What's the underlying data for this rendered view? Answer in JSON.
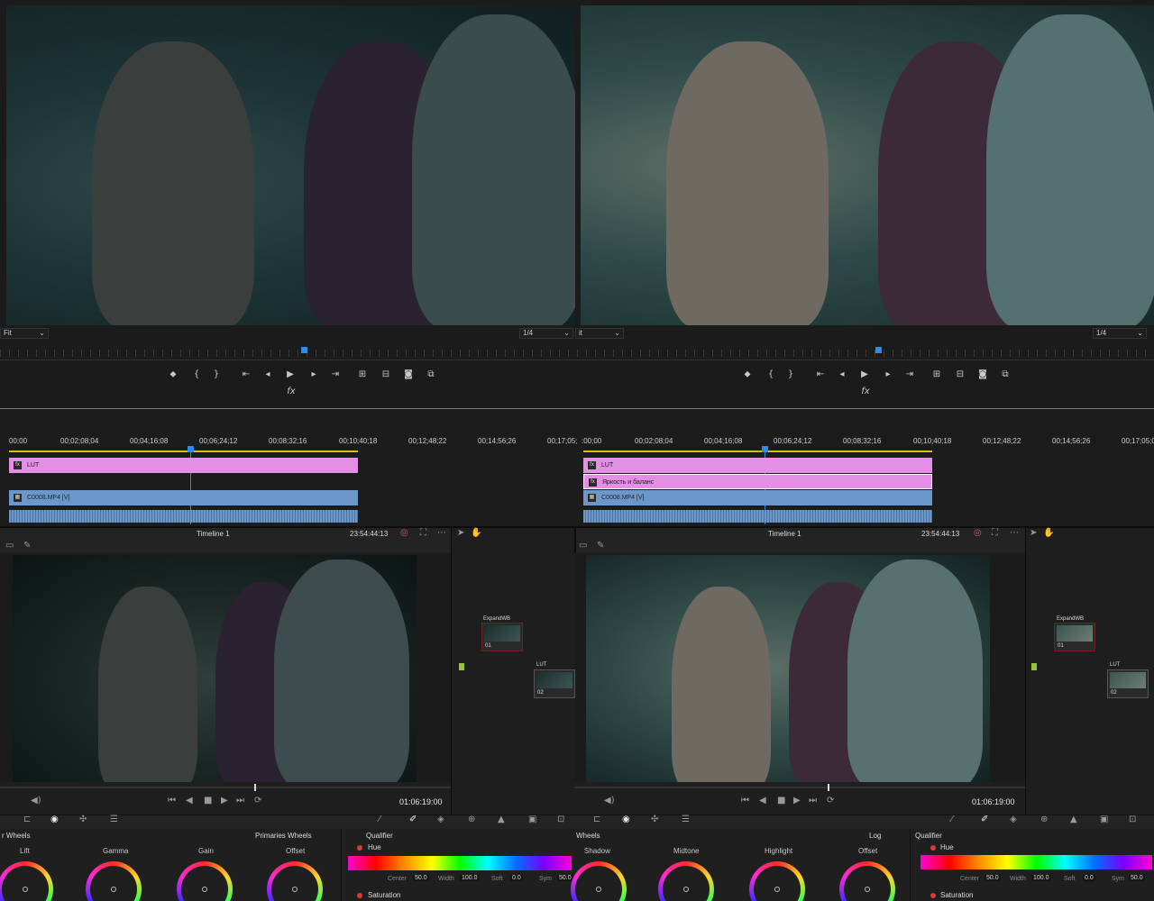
{
  "premiere_left": {
    "fit": "Fit",
    "resolution": "1/4",
    "fx_label": "fx",
    "ruler": [
      "00;00",
      "00;02;08;04",
      "00;04;16;08",
      "00;06;24;12",
      "00;08;32;16",
      "00;10;40;18",
      "00;12;48;22",
      "00;14;56;26",
      "00;17;05;"
    ],
    "clips": [
      "LUT",
      "C0008.MP4 [V]"
    ]
  },
  "premiere_right": {
    "fit": "it",
    "resolution": "1/4",
    "fx_label": "fx",
    "ruler": [
      ":00;00",
      "00;02;08;04",
      "00;04;16;08",
      "00;06;24;12",
      "00;08;32;16",
      "00;10;40;18",
      "00;12;48;22",
      "00;14;56;26",
      "00;17;05;0"
    ],
    "clips": [
      "LUT",
      "Яркость и баланс",
      "C0008.MP4 [V]"
    ]
  },
  "resolve_left": {
    "timeline_name": "Timeline 1",
    "timecode_top": "23:54:44:13",
    "timecode_bottom": "01:06:19:00",
    "nodes": [
      {
        "label": "ExpandWB",
        "num": "01"
      },
      {
        "label": "LUT",
        "num": "02"
      }
    ],
    "wheels_title": "r Wheels",
    "wheels_mode": "Primaries Wheels",
    "wheels": [
      "Lift",
      "Gamma",
      "Gain",
      "Offset"
    ],
    "qualifier": {
      "title": "Qualifier",
      "hue": "Hue",
      "saturation": "Saturation",
      "params": [
        {
          "k": "Center",
          "v": "50.0"
        },
        {
          "k": "Width",
          "v": "100.0"
        },
        {
          "k": "Soft",
          "v": "0.0"
        },
        {
          "k": "Sym",
          "v": "50.0"
        }
      ]
    }
  },
  "resolve_right": {
    "timeline_name": "Timeline 1",
    "timecode_top": "23:54:44:13",
    "timecode_bottom": "01:06:19:00",
    "nodes": [
      {
        "label": "ExpandWB",
        "num": "01"
      },
      {
        "label": "LUT",
        "num": "02"
      }
    ],
    "wheels_title": "Wheels",
    "wheels_mode": "Log",
    "wheels": [
      "Shadow",
      "Midtone",
      "Highlight",
      "Offset"
    ],
    "qualifier": {
      "title": "Qualifier",
      "hue": "Hue",
      "saturation": "Saturation",
      "params": [
        {
          "k": "Center",
          "v": "50.0"
        },
        {
          "k": "Width",
          "v": "100.0"
        },
        {
          "k": "Soft",
          "v": "0.0"
        },
        {
          "k": "Sym",
          "v": "50.0"
        }
      ]
    }
  },
  "colors": {
    "accent": "#2d8ceb",
    "clip_pink": "#e48ee6",
    "clip_blue": "#6b98c9",
    "node_border": "#6c2222"
  }
}
